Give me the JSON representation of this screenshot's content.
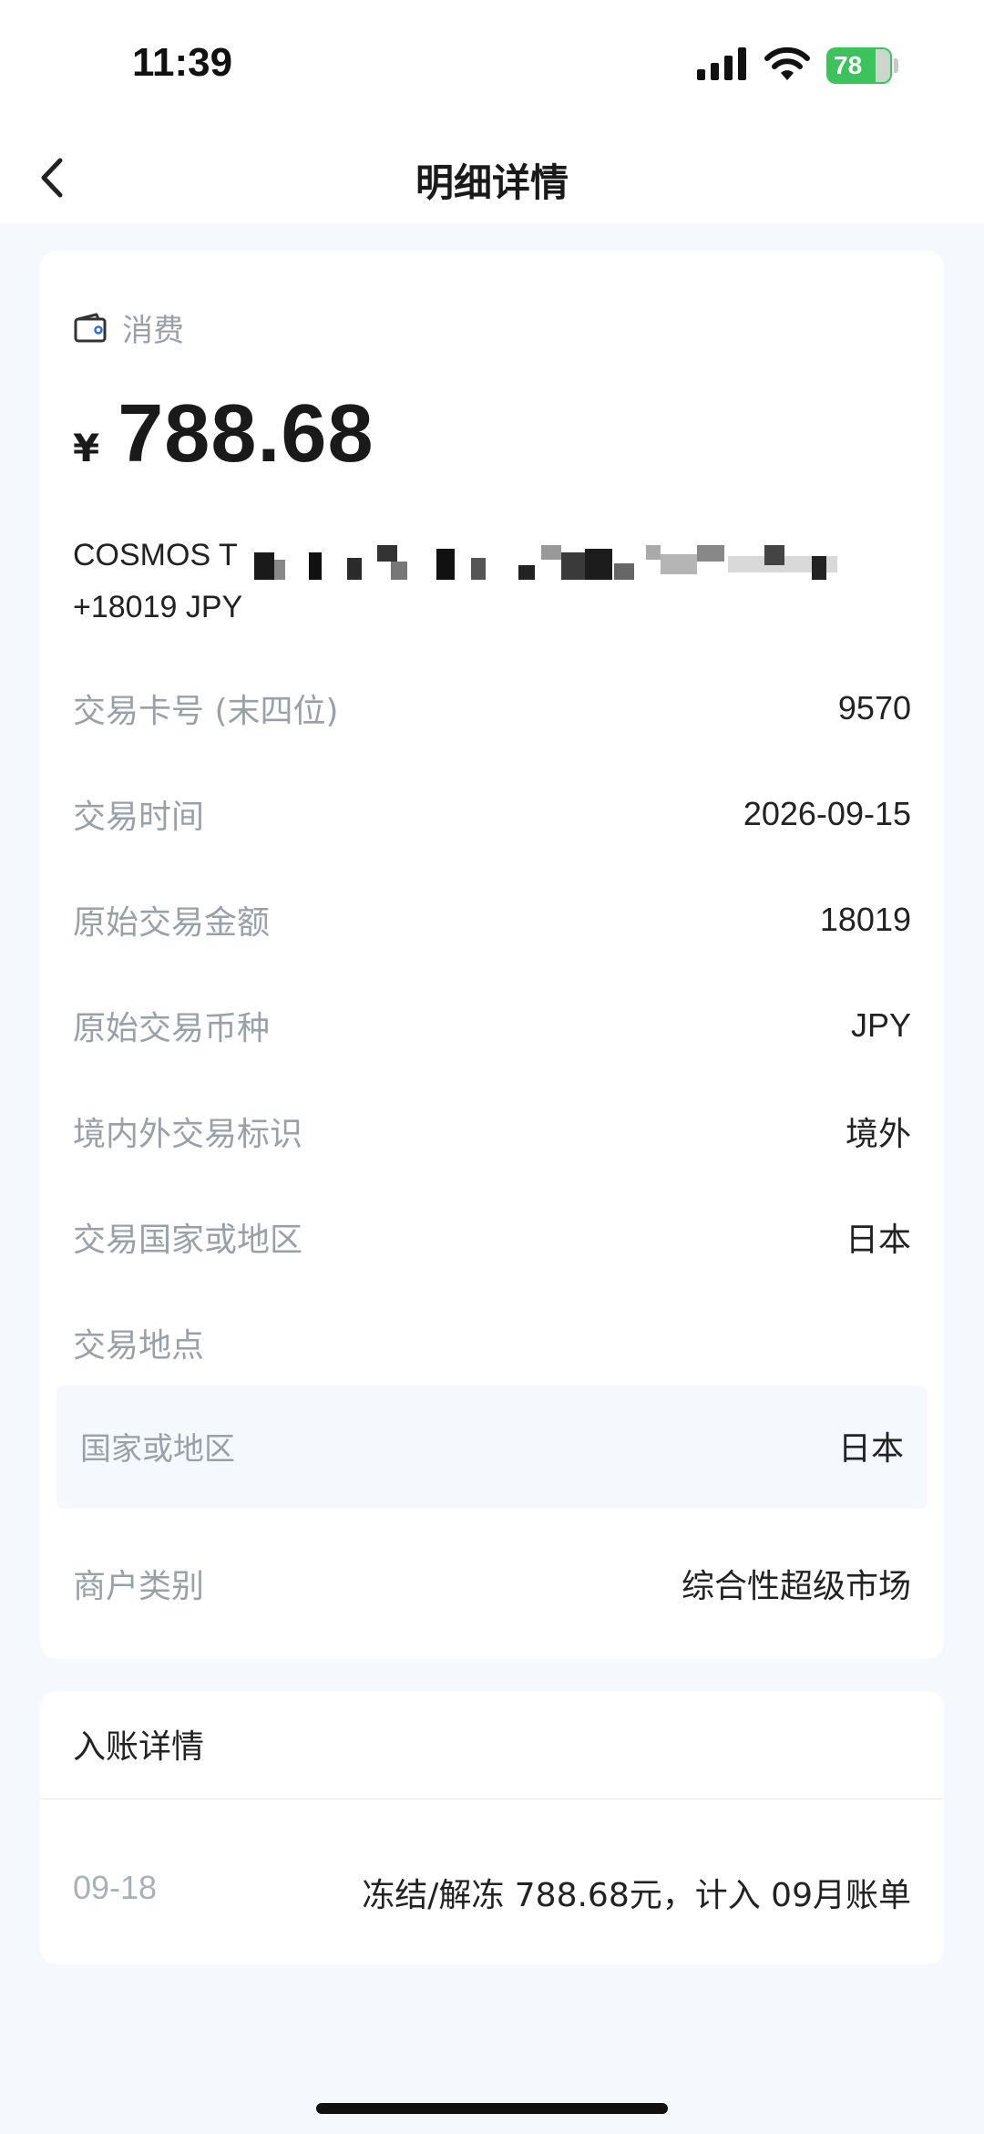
{
  "status_bar": {
    "time": "11:39",
    "battery_level": "78",
    "signal_icon": "cellular-signal-icon",
    "wifi_icon": "wifi-icon",
    "battery_color": "#3cc35b"
  },
  "nav": {
    "title": "明细详情",
    "back_icon": "chevron-left-icon"
  },
  "transaction": {
    "type_icon": "wallet-icon",
    "type_label": "消费",
    "currency_symbol": "¥",
    "amount": "788.68",
    "merchant_line1_visible": "COSMOS T",
    "merchant_line2": "+18019 JPY"
  },
  "details": [
    {
      "label": "交易卡号 (末四位)",
      "value": "9570"
    },
    {
      "label": "交易时间",
      "value": "2026-09-15"
    },
    {
      "label": "原始交易金额",
      "value": "18019"
    },
    {
      "label": "原始交易币种",
      "value": "JPY"
    },
    {
      "label": "境内外交易标识",
      "value": "境外"
    },
    {
      "label": "交易国家或地区",
      "value": "日本"
    },
    {
      "label": "交易地点",
      "value": ""
    }
  ],
  "location_sub": {
    "label": "国家或地区",
    "value": "日本"
  },
  "merchant_category": {
    "label": "商户类别",
    "value": "综合性超级市场"
  },
  "bill": {
    "heading": "入账详情",
    "date": "09-18",
    "description": "冻结/解冻 788.68元，计入 09月账单"
  }
}
